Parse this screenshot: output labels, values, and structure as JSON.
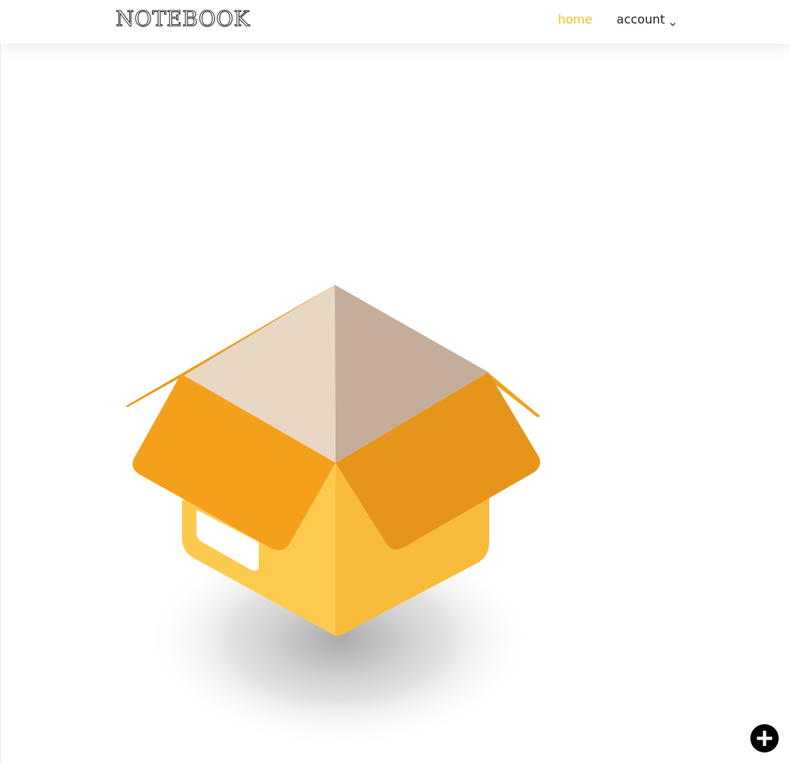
{
  "brand": {
    "title": "NOTEBOOK"
  },
  "nav": {
    "home_label": "home",
    "account_label": "account",
    "account_icon": "chevron-down-icon"
  },
  "main": {
    "illustration": "empty-open-box-illustration",
    "colors": {
      "flap_left": "#F5A01A",
      "flap_right": "#E7951A",
      "box_front_left": "#FCCB4E",
      "box_front_right": "#F9BB3B",
      "lid_inside_left": "#E8D8C3",
      "lid_inside_right": "#C4AE9A"
    }
  },
  "fab": {
    "icon": "plus-icon"
  },
  "theme": {
    "accent": "#F3C316",
    "text": "#222222",
    "background": "#FFFFFF"
  }
}
